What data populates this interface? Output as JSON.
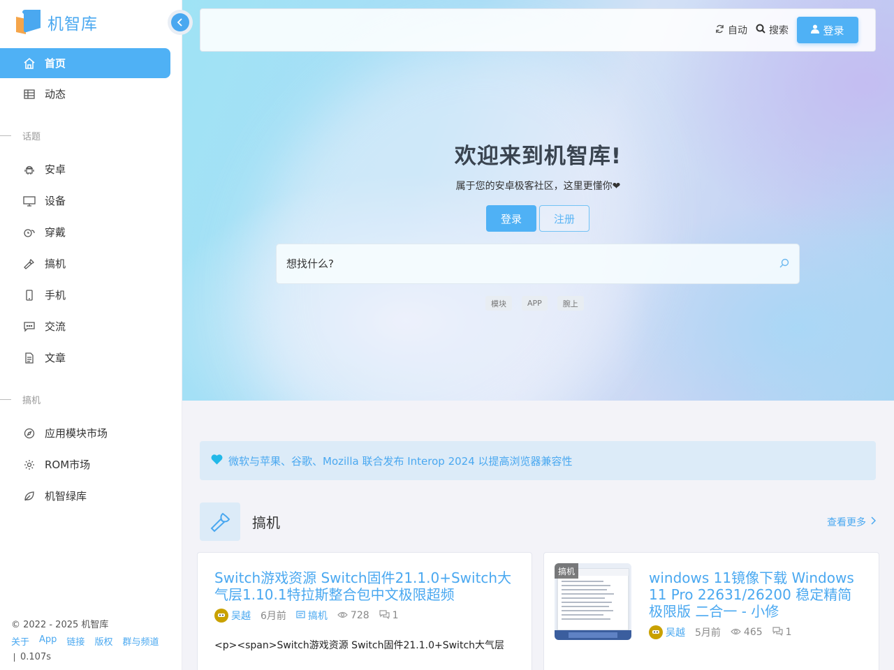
{
  "brand": {
    "name": "机智库",
    "logo_icon": "book-logo-icon"
  },
  "sidebar": {
    "collapse_icon": "chevron-left-icon",
    "items_top": [
      {
        "label": "首页",
        "icon": "home-icon",
        "active": true
      },
      {
        "label": "动态",
        "icon": "table-icon",
        "active": false
      }
    ],
    "section_topics": "话题",
    "topics": [
      {
        "label": "安卓",
        "icon": "android-icon"
      },
      {
        "label": "设备",
        "icon": "monitor-icon"
      },
      {
        "label": "穿戴",
        "icon": "watch-icon"
      },
      {
        "label": "搞机",
        "icon": "wrench-icon"
      },
      {
        "label": "手机",
        "icon": "phone-icon"
      },
      {
        "label": "交流",
        "icon": "chat-icon"
      },
      {
        "label": "文章",
        "icon": "document-icon"
      }
    ],
    "section_tinker": "搞机",
    "tinker": [
      {
        "label": "应用模块市场",
        "icon": "compass-icon"
      },
      {
        "label": "ROM市场",
        "icon": "gear-icon"
      },
      {
        "label": "机智绿库",
        "icon": "leaf-icon"
      }
    ],
    "footer": {
      "copyright": "© 2022 - 2025 机智库",
      "links": [
        "关于",
        "App",
        "链接",
        "版权",
        "群与频道"
      ],
      "timing": "0.107s"
    }
  },
  "topbar": {
    "theme_label": "自动",
    "theme_icon": "refresh-icon",
    "search_label": "搜索",
    "search_icon": "search-icon",
    "login_label": "登录",
    "login_icon": "user-icon"
  },
  "hero": {
    "title": "欢迎来到机智库!",
    "subtitle": "属于您的安卓极客社区，这里更懂你❤",
    "login_label": "登录",
    "register_label": "注册",
    "search_placeholder": "想找什么?",
    "tags": [
      "模块",
      "APP",
      "腕上"
    ]
  },
  "notice": {
    "icon": "heart-icon",
    "text": "微软与苹果、谷歌、Mozilla 联合发布 Interop 2024 以提高浏览器兼容性"
  },
  "section": {
    "title": "搞机",
    "icon": "wrench-icon",
    "more_label": "查看更多"
  },
  "posts": [
    {
      "title": "Switch游戏资源 Switch固件21.1.0+Switch大气层1.10.1特拉斯整合包中文极限超频",
      "author": "吴越",
      "time": "6月前",
      "category": "搞机",
      "views": "728",
      "comments": "1",
      "excerpt": "<p><span>Switch游戏资源  Switch固件21.1.0+Switch大气层"
    },
    {
      "title": "windows 11镜像下载 Windows 11 Pro 22631/26200 稳定精简 极限版 二合一 - 小修",
      "author": "吴越",
      "time": "5月前",
      "views": "465",
      "comments": "1",
      "thumb_tag": "搞机"
    }
  ]
}
